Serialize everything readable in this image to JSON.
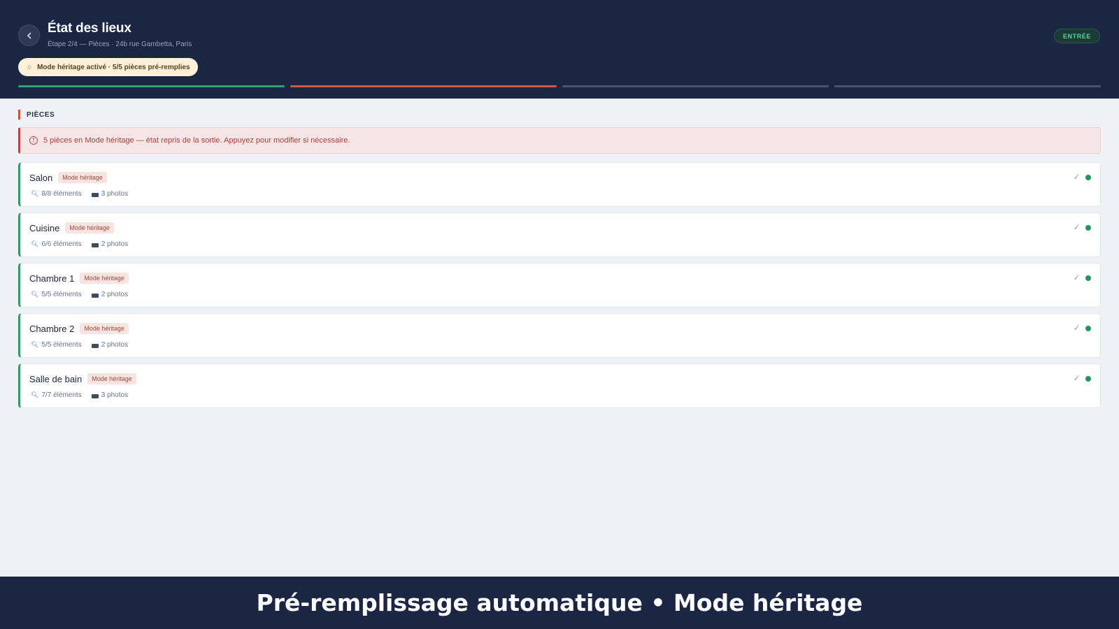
{
  "header": {
    "title": "État des lieux",
    "subtitle": "Étape 2/4 — Pièces · 24b rue Gambetta, Paris",
    "status_badge": "ENTRÉE",
    "mode_pill": "Mode héritage activé · 5/5 pièces pré-remplies",
    "back_icon": "chevron-left-icon",
    "mode_icon": "sun-icon"
  },
  "progress": {
    "current_step": 2,
    "total_steps": 4,
    "colors": {
      "done": "#2fa36b",
      "current": "#d05a3f",
      "upcoming": "#4a5471"
    }
  },
  "section": {
    "label": "PIÈCES"
  },
  "alert": {
    "icon": "alert-circle-icon",
    "text": "5 pièces en Mode héritage — état repris de la sortie. Appuyez pour modifier si nécessaire."
  },
  "rooms": [
    {
      "name": "Salon",
      "tag": "Mode héritage",
      "elements": "8/8 éléments",
      "photos": "3 photos",
      "check": "✓"
    },
    {
      "name": "Cuisine",
      "tag": "Mode héritage",
      "elements": "6/6 éléments",
      "photos": "2 photos",
      "check": "✓"
    },
    {
      "name": "Chambre 1",
      "tag": "Mode héritage",
      "elements": "5/5 éléments",
      "photos": "2 photos",
      "check": "✓"
    },
    {
      "name": "Chambre 2",
      "tag": "Mode héritage",
      "elements": "5/5 éléments",
      "photos": "2 photos",
      "check": "✓"
    },
    {
      "name": "Salle de bain",
      "tag": "Mode héritage",
      "elements": "7/7 éléments",
      "photos": "3 photos",
      "check": "✓"
    }
  ],
  "caption": {
    "text": "Pré-remplissage automatique • Mode héritage"
  },
  "colors": {
    "header_bg": "#1b2644",
    "page_bg": "#eef1f5",
    "accent_green": "#2e9a63",
    "accent_red": "#d24e34"
  }
}
